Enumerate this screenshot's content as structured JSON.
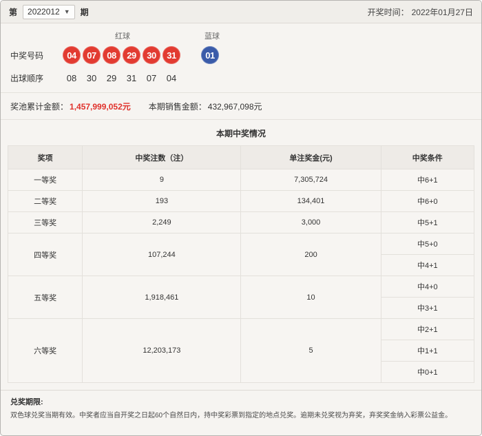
{
  "page": {
    "period_prefix": "第",
    "period_value": "2022012",
    "period_suffix": "期",
    "draw_time_label": "开奖时间：",
    "draw_time_value": "2022年01月27日"
  },
  "numbers": {
    "winning_label": "中奖号码",
    "order_label": "出球顺序",
    "red_label": "红球",
    "blue_label": "蓝球",
    "red_balls": [
      "04",
      "07",
      "08",
      "29",
      "30",
      "31"
    ],
    "blue_balls": [
      "01"
    ],
    "order": [
      "08",
      "30",
      "29",
      "31",
      "07",
      "04"
    ]
  },
  "amounts": {
    "jackpot_label": "奖池累计金额：",
    "jackpot_value": "1,457,999,052元",
    "sales_label": "本期销售金额：",
    "sales_value": "432,967,098元"
  },
  "prize_table": {
    "title": "本期中奖情况",
    "headers": [
      "奖项",
      "中奖注数（注）",
      "单注奖金(元)",
      "中奖条件"
    ],
    "rows": [
      {
        "prize": "一等奖",
        "count": "9",
        "amount": "7,305,724",
        "conditions": [
          "中6+1"
        ]
      },
      {
        "prize": "二等奖",
        "count": "193",
        "amount": "134,401",
        "conditions": [
          "中6+0"
        ]
      },
      {
        "prize": "三等奖",
        "count": "2,249",
        "amount": "3,000",
        "conditions": [
          "中5+1"
        ]
      },
      {
        "prize": "四等奖",
        "count": "107,244",
        "amount": "200",
        "conditions": [
          "中5+0",
          "中4+1"
        ]
      },
      {
        "prize": "五等奖",
        "count": "1,918,461",
        "amount": "10",
        "conditions": [
          "中4+0",
          "中3+1"
        ]
      },
      {
        "prize": "六等奖",
        "count": "12,203,173",
        "amount": "5",
        "conditions": [
          "中2+1",
          "中1+1",
          "中0+1"
        ]
      }
    ]
  },
  "footer": {
    "deadline_label": "兑奖期限:",
    "deadline_text": "双色球兑奖当期有效。中奖者应当自开奖之日起60个自然日内，持中奖彩票到指定的地点兑奖。逾期未兑奖视为弃奖，弃奖奖金纳入彩票公益金。"
  },
  "colors": {
    "red_ball": "#e23b31",
    "blue_ball": "#3a5ba9",
    "jackpot_red": "#e0322c"
  }
}
